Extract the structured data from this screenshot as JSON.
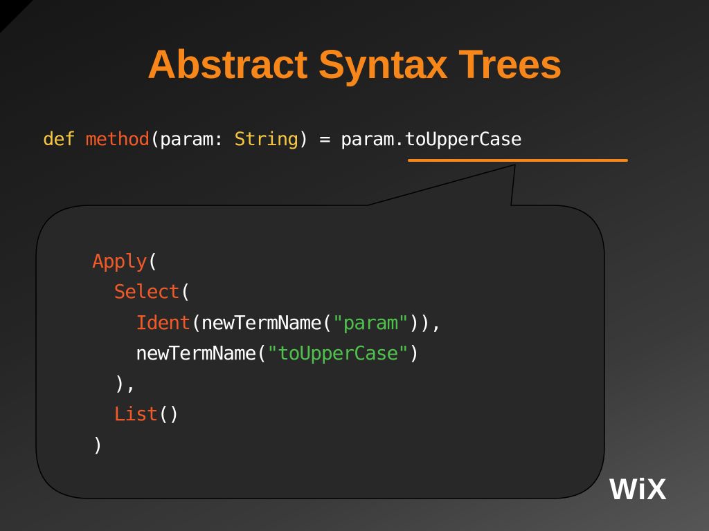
{
  "slide": {
    "title": "Abstract Syntax Trees",
    "colors": {
      "title": "#f7871a",
      "keyword": "#f6c744",
      "name": "#f05a28",
      "text": "#ffffff",
      "string": "#4ec04b",
      "underline": "#f7871a",
      "bubble_fill": "#282828",
      "bubble_stroke": "#000000"
    }
  },
  "code": {
    "kw_def": "def",
    "sp1": " ",
    "method": "method",
    "p1": "(param: ",
    "type": "String",
    "p2": ") = ",
    "expr": "param.toUpperCase"
  },
  "ast": {
    "l1_fn": "Apply",
    "l1_rest": "(",
    "l2_indent": "  ",
    "l2_fn": "Select",
    "l2_rest": "(",
    "l3_indent": "    ",
    "l3_fn": "Ident",
    "l3_a": "(newTermName(",
    "l3_str": "\"param\"",
    "l3_b": ")),",
    "l4_indent": "    ",
    "l4_a": "newTermName(",
    "l4_str": "\"toUpperCase\"",
    "l4_b": ")",
    "l5": "  ),",
    "l6_indent": "  ",
    "l6_fn": "List",
    "l6_rest": "()",
    "l7": ")"
  },
  "logo": {
    "text": "WiX",
    "icon": "wix-logo"
  }
}
